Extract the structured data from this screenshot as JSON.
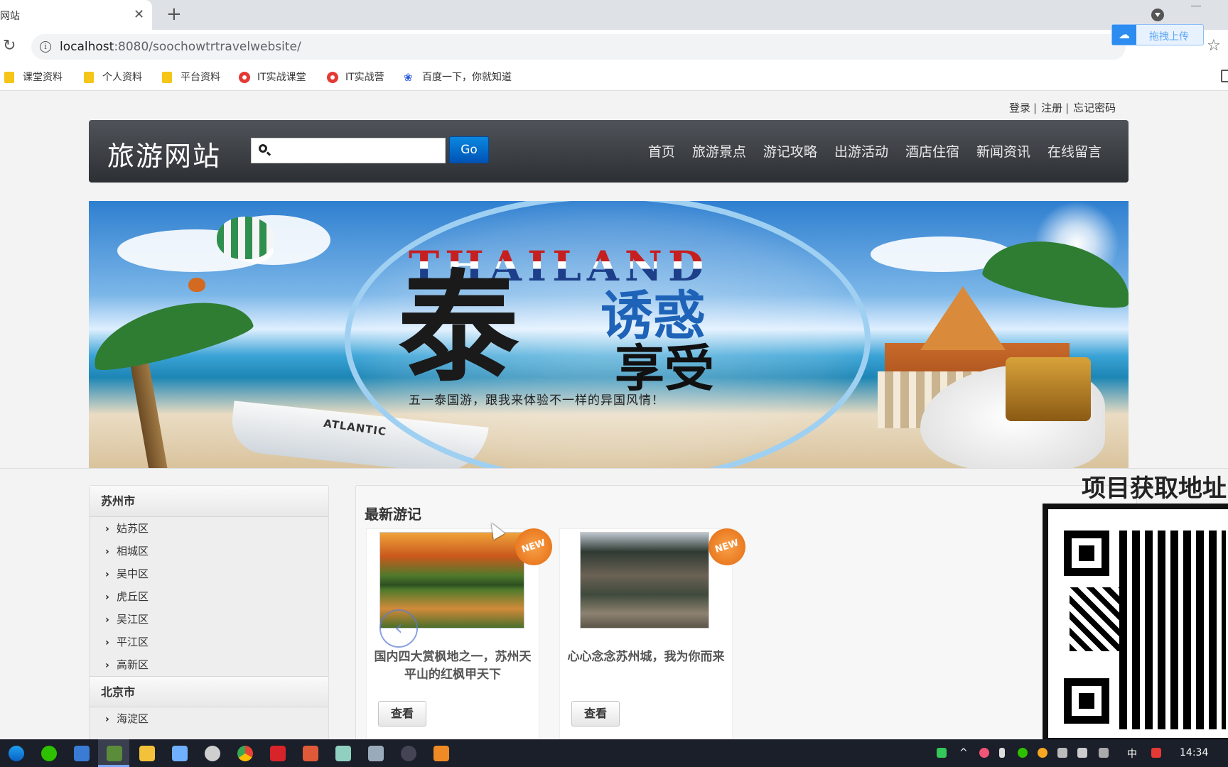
{
  "browser": {
    "tab_title": "网站",
    "url_host": "localhost",
    "url_rest": ":8080/soochowtrtravelwebsite/",
    "upload_label": "拖拽上传",
    "bookmarks": [
      "课堂资料",
      "个人资料",
      "平台资料",
      "IT实战课堂",
      "IT实战营",
      "百度一下，你就知道"
    ]
  },
  "header": {
    "login": "登录",
    "register": "注册",
    "forgot": "忘记密码",
    "sep": "|"
  },
  "navbar": {
    "brand": "旅游网站",
    "search_placeholder": "",
    "go_label": "Go",
    "links": [
      "首页",
      "旅游景点",
      "游记攻略",
      "出游活动",
      "酒店住宿",
      "新闻资讯",
      "在线留言"
    ]
  },
  "banner": {
    "en_title": "THAILAND",
    "tai": "泰",
    "youhuo": "诱惑",
    "xiangshou": "享受",
    "subtitle": "五一泰国游，跟我来体验不一样的异国风情！",
    "boat_text": "ATLANTIC"
  },
  "sidebar": {
    "cities": [
      {
        "name": "苏州市",
        "districts": [
          "姑苏区",
          "相城区",
          "吴中区",
          "虎丘区",
          "吴江区",
          "平江区",
          "高新区"
        ]
      },
      {
        "name": "北京市",
        "districts": [
          "海淀区"
        ]
      }
    ]
  },
  "main": {
    "section_title": "最新游记",
    "new_badge": "NEW",
    "cards": [
      {
        "caption": "国内四大赏枫地之一，苏州天平山的红枫甲天下",
        "button": "查看"
      },
      {
        "caption": "心心念念苏州城，我为你而来",
        "button": "查看"
      }
    ]
  },
  "overlay": {
    "promo_title": "项目获取地址"
  },
  "taskbar": {
    "time": "14:34",
    "ime": "中"
  },
  "colors": {
    "navbar_bg": "#3a3e43",
    "go_button": "#0a6fd0",
    "new_badge": "#ee7d22"
  }
}
